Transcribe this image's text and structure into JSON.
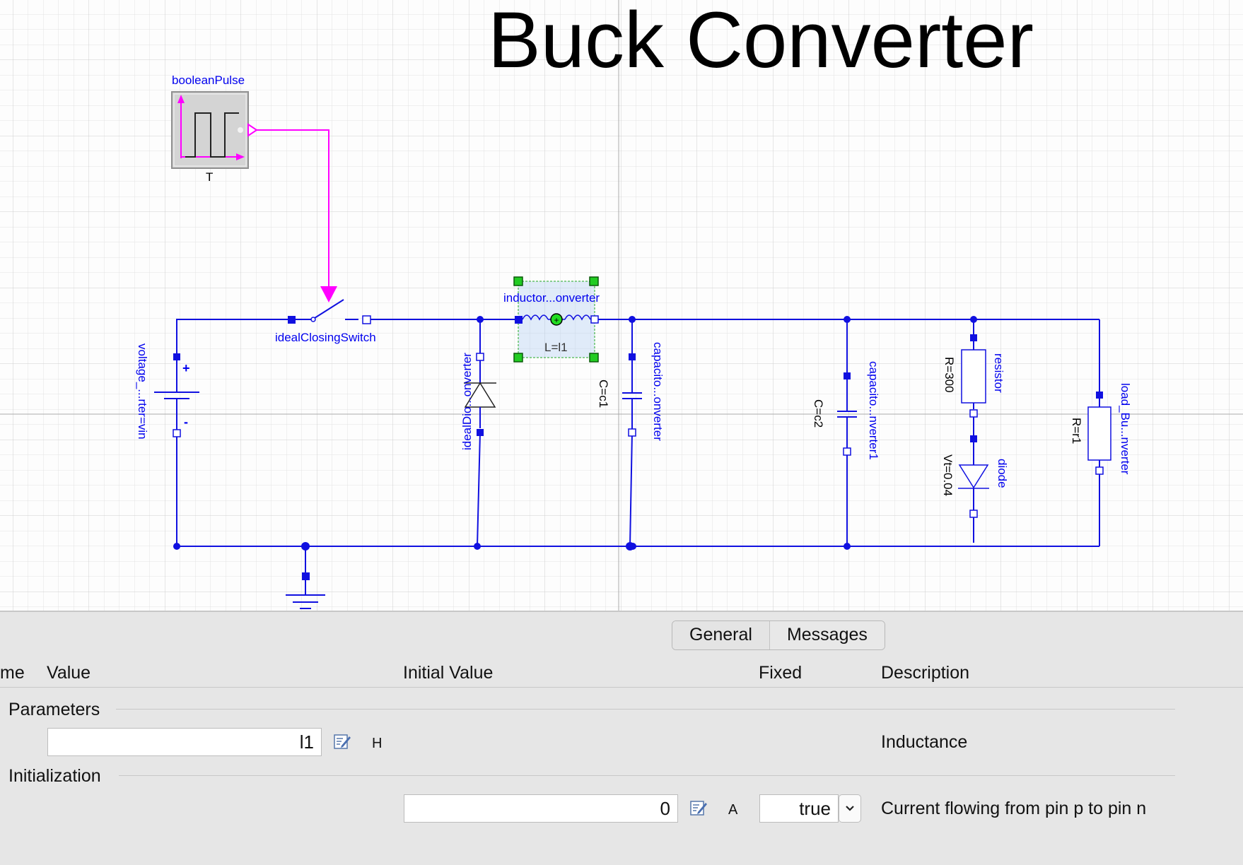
{
  "diagram": {
    "title": "Buck Converter",
    "components": {
      "boolean_pulse": {
        "name": "booleanPulse",
        "param": "T"
      },
      "switch": {
        "name": "idealClosingSwitch"
      },
      "voltage_source": {
        "name": "voltage_...rter=vin",
        "plus": "+",
        "minus": "-"
      },
      "ideal_diode": {
        "name": "idealDio...onverter"
      },
      "inductor": {
        "name": "inductor...onverter",
        "param": "L=l1"
      },
      "capacitor": {
        "name": "capacito...onverter",
        "param": "C=c1"
      },
      "capacitor1": {
        "name": "capacito...nverter1",
        "param": "C=c2"
      },
      "resistor": {
        "name": "resistor",
        "param": "R=300"
      },
      "diode": {
        "name": "diode",
        "param": "Vt=0.04"
      },
      "load": {
        "name": "load_Bu...nverter",
        "param": "R=r1"
      }
    },
    "colors": {
      "wire": "#1010e0",
      "signal": "#ff00ff",
      "selection": "#22cc22",
      "grid": "#d4d4d4"
    }
  },
  "panel": {
    "tabs": [
      {
        "label": "General"
      },
      {
        "label": "Messages"
      }
    ],
    "columns": {
      "name": "me",
      "value": "Value",
      "initial_value": "Initial Value",
      "fixed": "Fixed",
      "description": "Description"
    },
    "groups": {
      "parameters": {
        "label": "Parameters",
        "rows": [
          {
            "value": "l1",
            "unit": "H",
            "description": "Inductance",
            "edit_icon": "edit-icon"
          }
        ]
      },
      "initialization": {
        "label": "Initialization",
        "rows": [
          {
            "initial_value": "0",
            "unit": "A",
            "fixed": "true",
            "description": "Current flowing from pin p to pin n",
            "edit_icon": "edit-icon"
          }
        ]
      }
    }
  }
}
